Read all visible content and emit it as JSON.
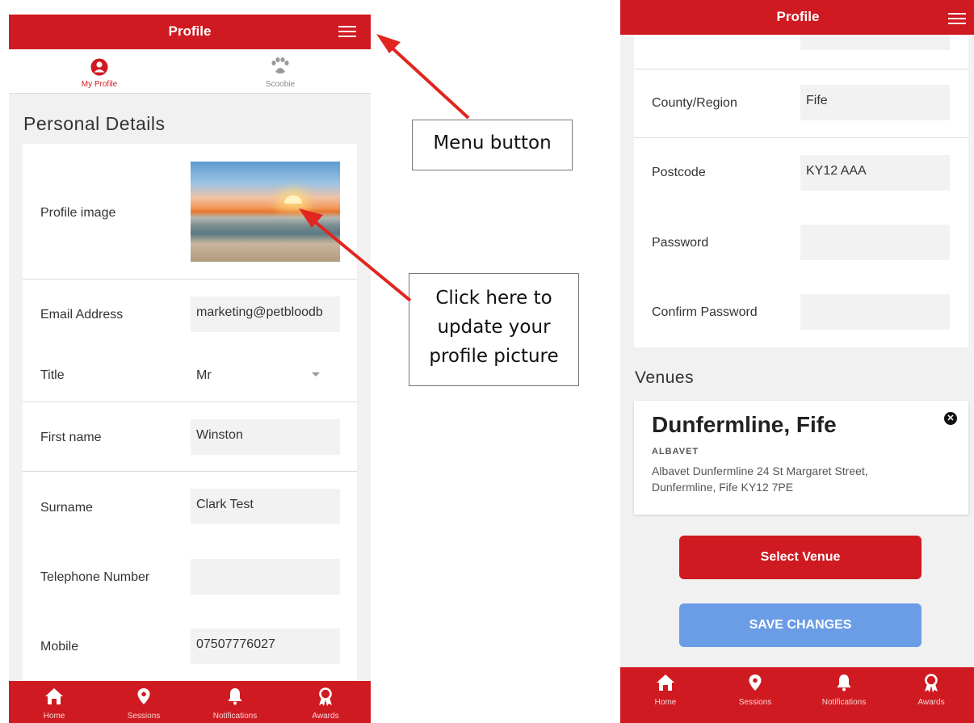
{
  "app": {
    "title": "Profile"
  },
  "tabs": [
    {
      "label": "My Profile",
      "icon": "user-circle-icon",
      "active": true
    },
    {
      "label": "Scoobie",
      "icon": "paw-icon",
      "active": false
    }
  ],
  "personal": {
    "heading": "Personal Details",
    "profile_image_label": "Profile image",
    "email": {
      "label": "Email Address",
      "value": "marketing@petbloodb"
    },
    "title": {
      "label": "Title",
      "value": "Mr"
    },
    "first_name": {
      "label": "First name",
      "value": "Winston"
    },
    "surname": {
      "label": "Surname",
      "value": "Clark Test"
    },
    "telephone": {
      "label": "Telephone Number",
      "value": ""
    },
    "mobile": {
      "label": "Mobile",
      "value": "07507776027"
    }
  },
  "address": {
    "county": {
      "label": "County/Region",
      "value": "Fife"
    },
    "postcode": {
      "label": "Postcode",
      "value": "KY12 AAA"
    },
    "password": {
      "label": "Password",
      "value": ""
    },
    "confirm_password": {
      "label": "Confirm Password",
      "value": ""
    }
  },
  "venues": {
    "heading": "Venues",
    "items": [
      {
        "name": "Dunfermline, Fife",
        "org": "ALBAVET",
        "address": "Albavet Dunfermline 24 St Margaret Street, Dunfermline,  Fife KY12 7PE"
      }
    ],
    "select_button": "Select Venue",
    "save_button": "SAVE CHANGES"
  },
  "bottom_nav": [
    {
      "label": "Home",
      "icon": "home-icon"
    },
    {
      "label": "Sessions",
      "icon": "map-pin-icon"
    },
    {
      "label": "Notifications",
      "icon": "bell-icon"
    },
    {
      "label": "Awards",
      "icon": "award-icon"
    }
  ],
  "annotations": {
    "menu": "Menu button",
    "picture": [
      "Click here to",
      "update your",
      "profile picture"
    ]
  },
  "colors": {
    "brand_red": "#d01a21",
    "save_blue": "#6b9de6",
    "field_bg": "#f2f2f2",
    "annotation_arrow": "#e0261f"
  }
}
